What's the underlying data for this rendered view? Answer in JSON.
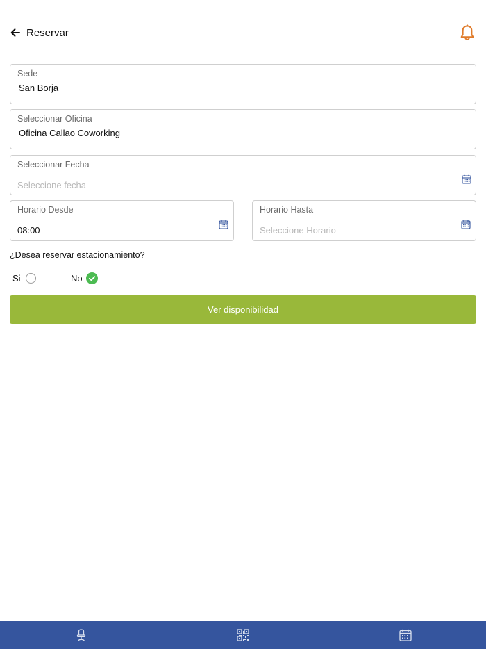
{
  "header": {
    "title": "Reservar",
    "back_icon": "arrow-left-icon",
    "notification_icon": "bell-icon",
    "accent_color": "#e07b2a"
  },
  "form": {
    "sede": {
      "label": "Sede",
      "value": "San Borja"
    },
    "oficina": {
      "label": "Seleccionar Oficina",
      "value": "Oficina Callao Coworking"
    },
    "fecha": {
      "label": "Seleccionar Fecha",
      "placeholder": "Seleccione fecha",
      "icon": "calendar-icon"
    },
    "horario_desde": {
      "label": "Horario Desde",
      "value": "08:00",
      "icon": "calendar-icon"
    },
    "horario_hasta": {
      "label": "Horario Hasta",
      "placeholder": "Seleccione Horario",
      "icon": "calendar-icon"
    }
  },
  "parking": {
    "question": "¿Desea reservar estacionamiento?",
    "options": [
      {
        "label": "Si",
        "selected": false
      },
      {
        "label": "No",
        "selected": true
      }
    ],
    "selected_color": "#4cbb52"
  },
  "action": {
    "label": "Ver disponibilidad",
    "color": "#99b83a"
  },
  "tabbar": {
    "color": "#35559e",
    "items": [
      {
        "icon": "desk-chair-icon"
      },
      {
        "icon": "qr-code-icon"
      },
      {
        "icon": "calendar-icon"
      }
    ]
  }
}
